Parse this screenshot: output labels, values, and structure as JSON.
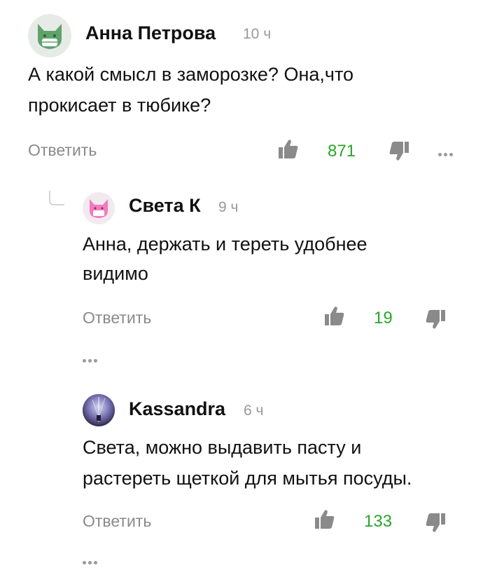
{
  "comments": [
    {
      "author": "Анна Петрова",
      "time": "10 ч",
      "text_line1": "А какой смысл в заморозке? Она,что",
      "text_line2": "прокисает в тюбике?",
      "reply_label": "Ответить",
      "likes": "871",
      "avatar_icon": "fox-avatar-green-icon"
    },
    {
      "author": "Света К",
      "time": "9 ч",
      "text_line1": "Анна, держать и тереть удобнее",
      "text_line2": "видимо",
      "reply_label": "Ответить",
      "likes": "19",
      "avatar_icon": "fox-avatar-pink-icon"
    },
    {
      "author": "Kassandra",
      "time": "6 ч",
      "text_line1": "Света, можно выдавить пасту и",
      "text_line2": "растереть щеткой для мытья посуды.",
      "reply_label": "Ответить",
      "likes": "133",
      "avatar_icon": "photo-avatar-icon"
    }
  ],
  "colors": {
    "like_count": "#2aa52a",
    "muted": "#8a8a8a",
    "avatar_green": "#5fa36b",
    "avatar_pink": "#f27bbf"
  }
}
